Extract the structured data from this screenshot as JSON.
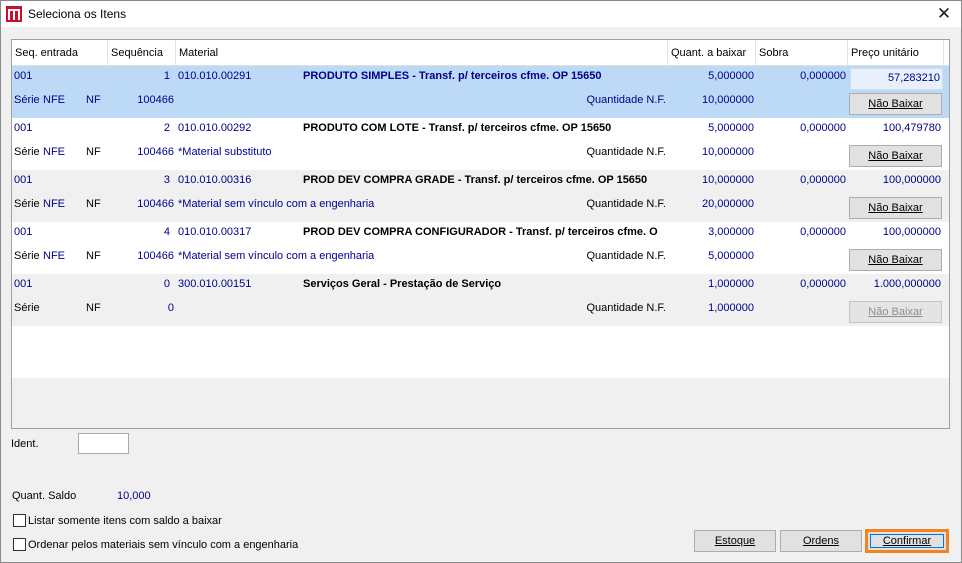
{
  "window": {
    "title": "Seleciona os Itens",
    "close_glyph": "✕"
  },
  "grid": {
    "headers": [
      "Seq. entrada",
      "Sequência",
      "Material",
      "Quant. a baixar",
      "Sobra",
      "Preço unitário"
    ],
    "rows": [
      {
        "seq_entrada": "001",
        "sequencia": "1",
        "material_code": "010.010.00291",
        "description": "PRODUTO SIMPLES - Transf. p/ terceiros cfme. OP 15650",
        "quant_baixar": "5,000000",
        "sobra": "0,000000",
        "preco": "57,283210",
        "serie_label": "Série",
        "serie": "NFE",
        "nf_label": "NF",
        "nf": "100466",
        "note": "",
        "qnf_label": "Quantidade N.F.",
        "qnf": "10,000000",
        "button": "Não Baixar",
        "selected": true,
        "disabled": false
      },
      {
        "seq_entrada": "001",
        "sequencia": "2",
        "material_code": "010.010.00292",
        "description": "PRODUTO COM LOTE - Transf. p/ terceiros cfme. OP 15650",
        "quant_baixar": "5,000000",
        "sobra": "0,000000",
        "preco": "100,479780",
        "serie_label": "Série",
        "serie": "NFE",
        "nf_label": "NF",
        "nf": "100466",
        "note": "*Material substituto",
        "qnf_label": "Quantidade N.F.",
        "qnf": "10,000000",
        "button": "Não Baixar",
        "selected": false,
        "disabled": false
      },
      {
        "seq_entrada": "001",
        "sequencia": "3",
        "material_code": "010.010.00316",
        "description": "PROD DEV COMPRA GRADE - Transf. p/ terceiros cfme. OP 15650",
        "quant_baixar": "10,000000",
        "sobra": "0,000000",
        "preco": "100,000000",
        "serie_label": "Série",
        "serie": "NFE",
        "nf_label": "NF",
        "nf": "100466",
        "note": "*Material sem vínculo com a engenharia",
        "qnf_label": "Quantidade N.F.",
        "qnf": "20,000000",
        "button": "Não Baixar",
        "selected": false,
        "disabled": false
      },
      {
        "seq_entrada": "001",
        "sequencia": "4",
        "material_code": "010.010.00317",
        "description": "PROD DEV COMPRA CONFIGURADOR - Transf. p/ terceiros cfme. O",
        "quant_baixar": "3,000000",
        "sobra": "0,000000",
        "preco": "100,000000",
        "serie_label": "Série",
        "serie": "NFE",
        "nf_label": "NF",
        "nf": "100466",
        "note": "*Material sem vínculo com a engenharia",
        "qnf_label": "Quantidade N.F.",
        "qnf": "5,000000",
        "button": "Não Baixar",
        "selected": false,
        "disabled": false
      },
      {
        "seq_entrada": "001",
        "sequencia": "0",
        "material_code": "300.010.00151",
        "description": "Serviços Geral - Prestação de Serviço",
        "quant_baixar": "1,000000",
        "sobra": "0,000000",
        "preco": "1.000,000000",
        "serie_label": "Série",
        "serie": "",
        "nf_label": "NF",
        "nf": "0",
        "note": "",
        "qnf_label": "Quantidade N.F.",
        "qnf": "1,000000",
        "button": "Não Baixar",
        "selected": false,
        "disabled": true
      }
    ]
  },
  "form": {
    "ident_label": "Ident.",
    "ident_value": "",
    "saldo_label": "Quant. Saldo",
    "saldo_value": "10,000",
    "check1_label": "Listar somente itens com saldo a baixar",
    "check2_label": "Ordenar pelos materiais sem vínculo com a engenharia"
  },
  "buttons": {
    "estoque": "Estoque",
    "ordens": "Ordens",
    "confirmar": "Confirmar"
  },
  "colors": {
    "selected_row": "#bcd9f5",
    "value_blue": "#00008b",
    "focus_orange": "#f58220"
  }
}
